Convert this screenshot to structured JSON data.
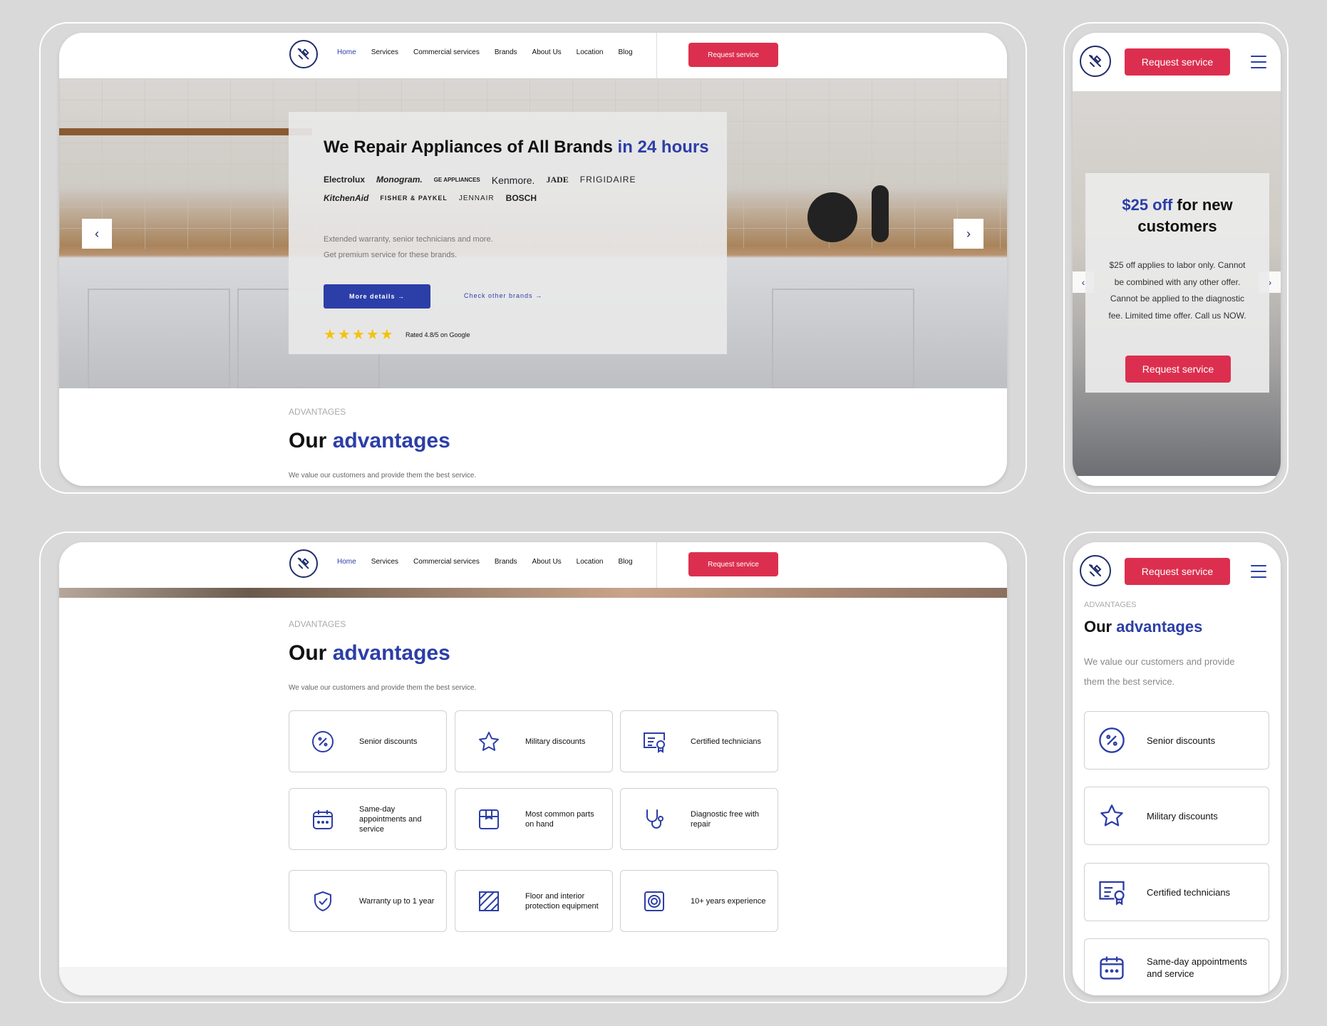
{
  "header": {
    "nav": [
      "Home",
      "Services",
      "Commercial services",
      "Brands",
      "About Us",
      "Location",
      "Blog"
    ],
    "request_label": "Request service"
  },
  "hero": {
    "title_main": "We Repair Appliances of All Brands",
    "title_accent": "in 24 hours",
    "brands": [
      "Electrolux",
      "Monogram.",
      "GE APPLIANCES",
      "Kenmore.",
      "JADE",
      "FRIGIDAIRE",
      "KitchenAid",
      "FISHER & PAYKEL",
      "JENNAIR",
      "BOSCH"
    ],
    "desc_line1": "Extended warranty, senior technicians and more.",
    "desc_line2": "Get premium service for these brands.",
    "more_label": "More details",
    "check_label": "Check other brands",
    "stars": "★★★★★",
    "rating_text": "Rated 4.8/5 on Google",
    "prev_glyph": "‹",
    "next_glyph": "›"
  },
  "advantages": {
    "eyebrow": "ADVANTAGES",
    "title_main": "Our",
    "title_accent": "advantages",
    "desc": "We value our customers and provide them the best service.",
    "items": [
      "Senior discounts",
      "Military discounts",
      "Certified technicians",
      "Same-day appointments and service",
      "Most common parts on hand",
      "Diagnostic free with repair",
      "Warranty up to 1 year",
      "Floor and interior protection equipment",
      "10+ years experience"
    ],
    "mobile_desc_line1": "We value our customers and provide",
    "mobile_desc_line2": "them the best service."
  },
  "promo": {
    "accent": "$25 off",
    "title_rest": "for new customers",
    "text": "$25 off applies to labor only. Cannot be combined with any other offer. Cannot be applied to the diagnostic fee. Limited time offer. Call us NOW.",
    "cta_label": "Request service"
  },
  "colors": {
    "brand_blue": "#2c3ea8",
    "cta_red": "#dc2f4f",
    "navy": "#1f2d6b"
  },
  "icons": {
    "logo": "tools-icon",
    "adv": [
      "percent-badge-icon",
      "star-icon",
      "certificate-icon",
      "calendar-icon",
      "parts-box-icon",
      "stethoscope-icon",
      "shield-check-icon",
      "floor-protection-icon",
      "experience-badge-icon"
    ]
  }
}
